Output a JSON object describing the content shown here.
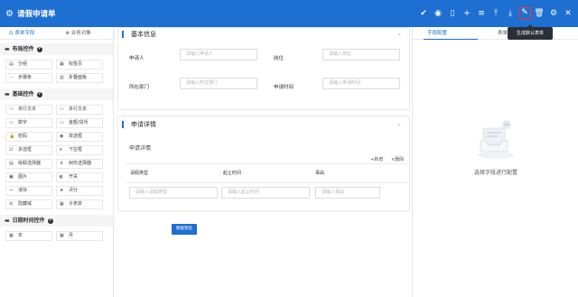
{
  "app": {
    "title": "请假申请单"
  },
  "toolbar": {
    "items": [
      {
        "name": "check-icon",
        "glyph": "✔"
      },
      {
        "name": "eye-icon",
        "glyph": "◉"
      },
      {
        "name": "mobile-icon",
        "glyph": "▯"
      },
      {
        "name": "plus-icon",
        "glyph": "+"
      },
      {
        "name": "menu-icon",
        "glyph": "≡"
      },
      {
        "name": "upload-icon",
        "glyph": "⤒"
      },
      {
        "name": "download-icon",
        "glyph": "⤓"
      },
      {
        "name": "wrench-icon",
        "glyph": "✎"
      },
      {
        "name": "trash-icon",
        "glyph": "🗑"
      },
      {
        "name": "settings-icon",
        "glyph": "⚙"
      },
      {
        "name": "close-icon",
        "glyph": "✕"
      }
    ],
    "tooltip": "生成默认表单"
  },
  "left": {
    "tabs": [
      "表单字段",
      "业务对象"
    ],
    "sections": [
      {
        "title": "布局控件",
        "items": [
          {
            "label": "分组",
            "glyph": "▤"
          },
          {
            "label": "标签页",
            "glyph": "▦"
          },
          {
            "label": "步骤条",
            "glyph": "⋯"
          },
          {
            "label": "折叠面板",
            "glyph": "▥"
          }
        ]
      },
      {
        "title": "基础控件",
        "items": [
          {
            "label": "单行文本",
            "glyph": "▭"
          },
          {
            "label": "多行文本",
            "glyph": "▭"
          },
          {
            "label": "数字",
            "glyph": "▭"
          },
          {
            "label": "金额/货币",
            "glyph": "▭"
          },
          {
            "label": "密码",
            "glyph": "🔒"
          },
          {
            "label": "单选框",
            "glyph": "◉"
          },
          {
            "label": "多选框",
            "glyph": "☑"
          },
          {
            "label": "下拉框",
            "glyph": "▾"
          },
          {
            "label": "级联选择器",
            "glyph": "▤"
          },
          {
            "label": "树形选择器",
            "glyph": "⋔"
          },
          {
            "label": "图片",
            "glyph": "▣"
          },
          {
            "label": "开关",
            "glyph": "◐"
          },
          {
            "label": "滑块",
            "glyph": "⊸"
          },
          {
            "label": "评分",
            "glyph": "★"
          },
          {
            "label": "隐藏域",
            "glyph": "⊘"
          },
          {
            "label": "子表单",
            "glyph": "▦"
          }
        ]
      },
      {
        "title": "日期时间控件",
        "items": [
          {
            "label": "年",
            "glyph": "▦"
          },
          {
            "label": "月",
            "glyph": "▦"
          }
        ]
      }
    ]
  },
  "form": {
    "basic": {
      "title": "基本信息",
      "applicant_label": "申请人",
      "applicant_placeholder": "请输入申请人",
      "position_label": "岗位",
      "position_placeholder": "请输入岗位",
      "dept_label": "所在部门",
      "dept_placeholder": "请输入所在部门",
      "date_label": "申请时间",
      "date_placeholder": "请输入申请时间"
    },
    "detail": {
      "title": "申请详情",
      "table_title": "申请详情",
      "add_label": "+新增",
      "delete_label": "×删除",
      "columns": [
        "请假类型",
        "起止时间",
        "事由"
      ],
      "placeholders": [
        "请输入请假类型",
        "请输入起止时间",
        "请输入事由"
      ]
    },
    "preview_button": "数据预览"
  },
  "right": {
    "tabs": [
      "字段配置",
      "表单配置"
    ],
    "empty_message": "选择字段进行配置"
  },
  "colors": {
    "primary": "#1d6fd1",
    "highlight": "#e23b3b"
  }
}
